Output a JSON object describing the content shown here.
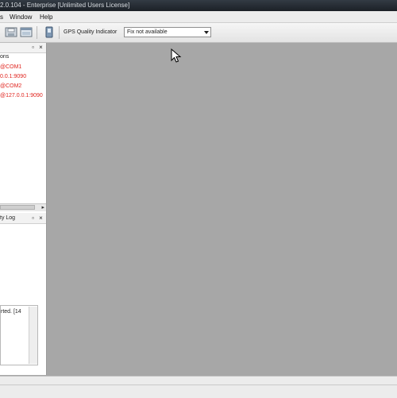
{
  "window": {
    "title": "2.0.104 - Enterprise  [Unlimited Users License]"
  },
  "menu": {
    "items": [
      "Window",
      "Help"
    ]
  },
  "toolbar": {
    "gps_label": "GPS Quality Indicator",
    "gps_value": "Fix not available",
    "icons": [
      "save-icon",
      "window-icon",
      "device-icon"
    ]
  },
  "connections_panel": {
    "title": "ons",
    "items": [
      "@COM1",
      "0.0.1:9090",
      "@COM2",
      "@127.0.0.1:9090"
    ]
  },
  "activity_panel": {
    "title": "ty Log"
  },
  "log": {
    "text": "rted. [14"
  },
  "colors": {
    "connection_text": "#e0241e",
    "workspace": "#a7a7a7"
  }
}
